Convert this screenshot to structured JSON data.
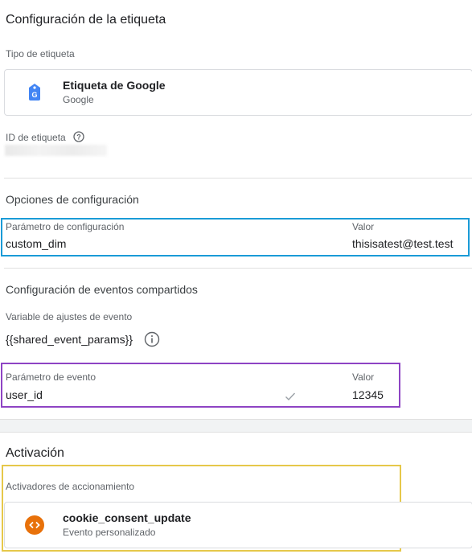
{
  "config": {
    "heading": "Configuración de la etiqueta",
    "tag_type_label": "Tipo de etiqueta",
    "tag_name": "Etiqueta de Google",
    "tag_vendor": "Google",
    "tag_id_label": "ID de etiqueta"
  },
  "config_options": {
    "heading": "Opciones de configuración",
    "param_header": "Parámetro de configuración",
    "value_header": "Valor",
    "param": "custom_dim",
    "value": "thisisatest@test.test"
  },
  "shared_events": {
    "heading": "Configuración de eventos compartidos",
    "variable_label": "Variable de ajustes de evento",
    "variable_value": "{{shared_event_params}}",
    "event_param_header": "Parámetro de evento",
    "value_header": "Valor",
    "event_param": "user_id",
    "event_value": "12345"
  },
  "activation": {
    "heading": "Activación",
    "triggers_label": "Activadores de accionamiento",
    "trigger_name": "cookie_consent_update",
    "trigger_type": "Evento personalizado"
  },
  "colors": {
    "highlight_blue": "#1a9bd7",
    "highlight_purple": "#8e44c4",
    "highlight_yellow": "#e6c84a",
    "trigger_icon_bg": "#e8710a",
    "tag_icon": "#4285f4"
  }
}
